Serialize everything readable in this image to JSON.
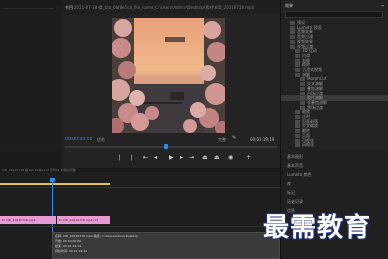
{
  "monitor": {
    "tab_label": "节目",
    "source_path": "2021-07-18 蝶_tab_0bf8e1c4_file_name_C:\\Users\\Admin\\Desktop\\素材\\VID_20210718.mp4",
    "timecode_current": "00:00:00:00",
    "fit_label": "适合",
    "quality_label": "完整",
    "timecode_total": "00:01:19:19"
  },
  "timeline": {
    "sequence_text": "VID_20210718 蝶 tab 0bf8e1c4 序列01 剪辑时间轴",
    "clip_labels": [
      "fx VID_20210718.mp4",
      "fx VID_20210718.mp4 [V]"
    ],
    "info_lines": [
      "名称: VID_20210718.mp4 路径: C:/Users/Admin/Desktop",
      "开始: 00:00:00:00",
      "结束: 00:01:19:19",
      "持续时间: 00:01:19:20"
    ]
  },
  "effects_panel": {
    "title": "效果",
    "search_placeholder": "",
    "items": [
      {
        "label": "预设",
        "selected": false,
        "indent": 1
      },
      {
        "label": "Lumetri 预设",
        "selected": false,
        "indent": 1
      },
      {
        "label": "音频效果",
        "selected": false,
        "indent": 1
      },
      {
        "label": "音频过渡",
        "selected": false,
        "indent": 1
      },
      {
        "label": "视频效果",
        "selected": false,
        "indent": 1
      },
      {
        "label": "视频过渡",
        "selected": false,
        "indent": 1
      },
      {
        "label": "3D 运动",
        "selected": false,
        "indent": 2
      },
      {
        "label": "内滑",
        "selected": false,
        "indent": 2
      },
      {
        "label": "划像",
        "selected": false,
        "indent": 2
      },
      {
        "label": "擦除",
        "selected": false,
        "indent": 2
      },
      {
        "label": "沉浸式视频",
        "selected": false,
        "indent": 2
      },
      {
        "label": "溶解",
        "selected": false,
        "indent": 2
      },
      {
        "label": "MorphCut",
        "selected": false,
        "indent": 3
      },
      {
        "label": "交叉溶解",
        "selected": false,
        "indent": 3
      },
      {
        "label": "叠加溶解",
        "selected": false,
        "indent": 3
      },
      {
        "label": "白场过渡",
        "selected": false,
        "indent": 3
      },
      {
        "label": "胶片溶解",
        "selected": true,
        "indent": 3
      },
      {
        "label": "非叠加溶解",
        "selected": false,
        "indent": 3
      },
      {
        "label": "黑场过渡",
        "selected": false,
        "indent": 3
      },
      {
        "label": "缩放",
        "selected": false,
        "indent": 2
      },
      {
        "label": "过时",
        "selected": false,
        "indent": 2
      },
      {
        "label": "页面剥落",
        "selected": false,
        "indent": 2
      },
      {
        "label": "交叉缩放",
        "selected": false,
        "indent": 2
      },
      {
        "label": "翻转",
        "selected": false,
        "indent": 2
      },
      {
        "label": "页面",
        "selected": false,
        "indent": 2
      },
      {
        "label": "可视化",
        "selected": false,
        "indent": 2
      },
      {
        "label": "风格化",
        "selected": false,
        "indent": 2
      }
    ]
  },
  "properties_panel": {
    "items": [
      "基本图形",
      "基本声音",
      "Lumetri 颜色",
      "库",
      "标记",
      "历史记录",
      "信息"
    ]
  },
  "watermark": {
    "text": "最需教育"
  },
  "colors": {
    "accent_blue": "#2d8ceb",
    "clip_pink": "#e89ad4",
    "work_area_yellow": "#e0c54a"
  }
}
